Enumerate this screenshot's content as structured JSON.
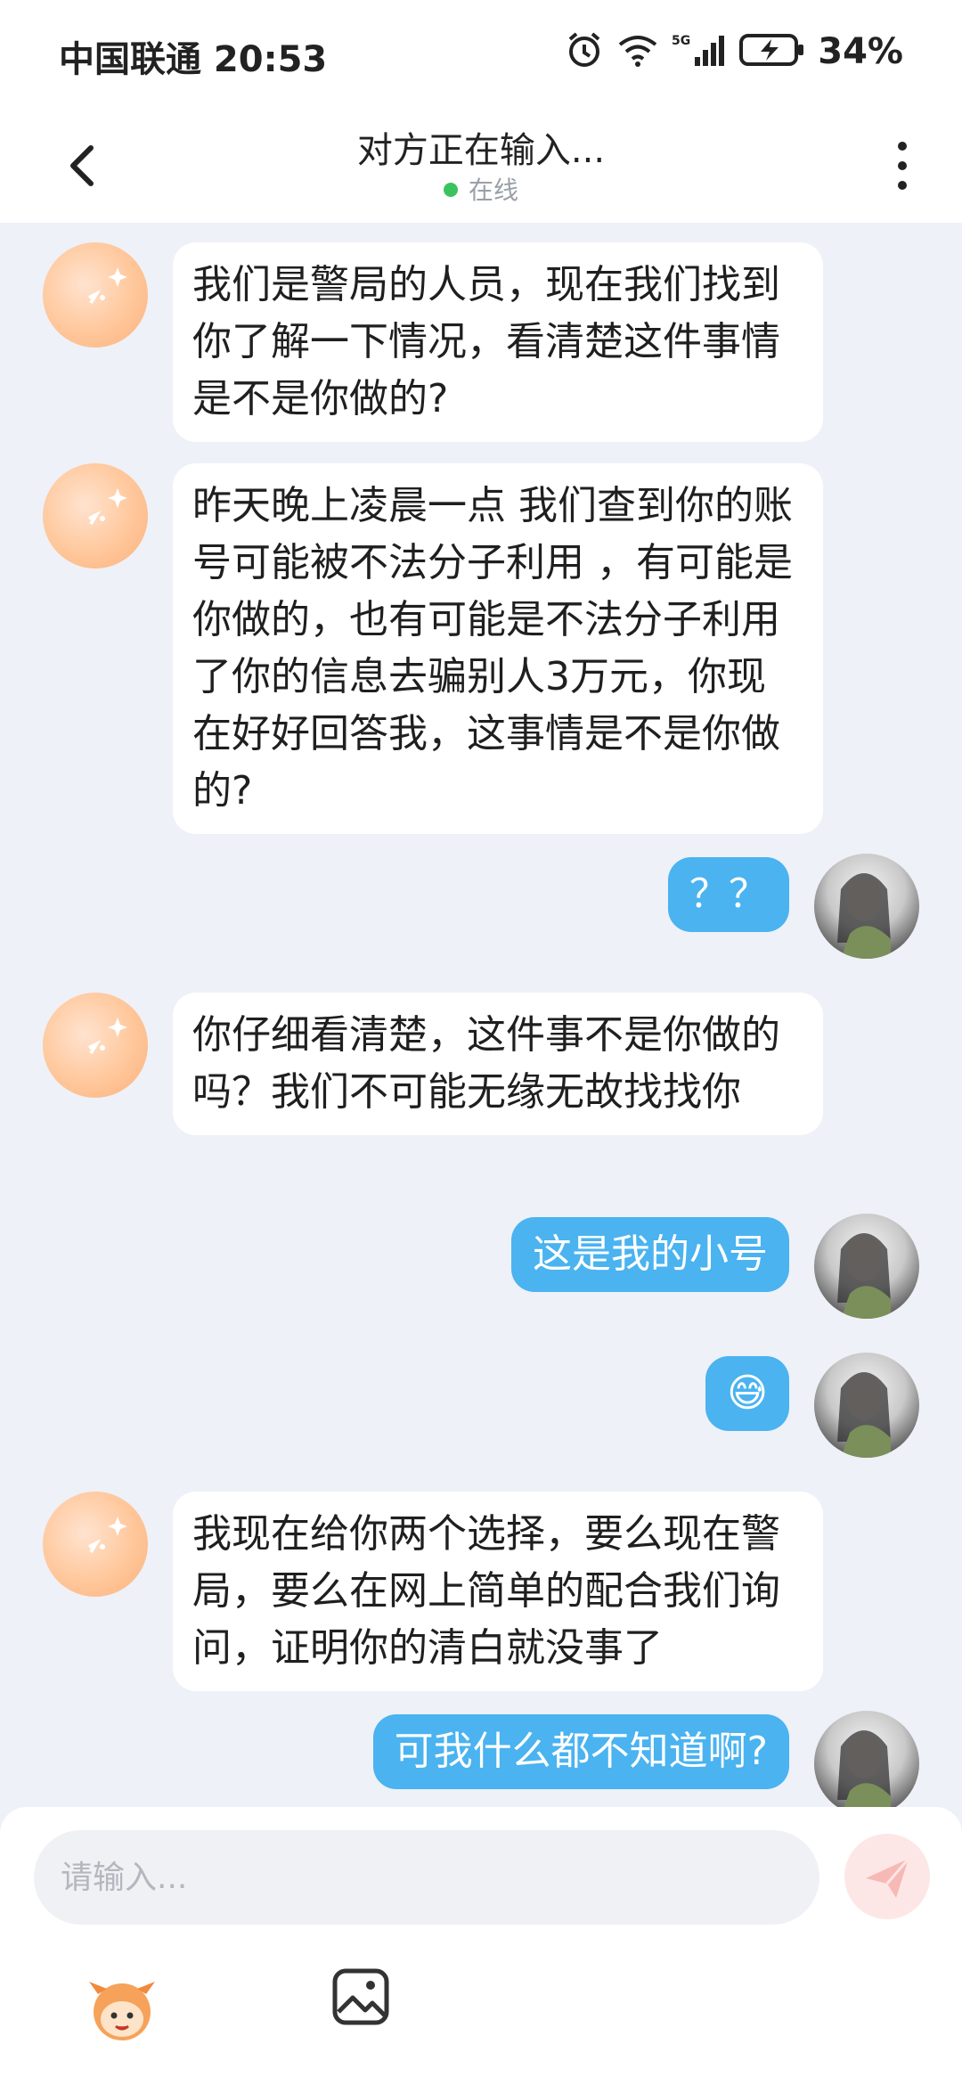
{
  "status_bar": {
    "carrier_time": "中国联通 20:53",
    "battery": "34%",
    "signal_label": "5G"
  },
  "header": {
    "title": "对方正在输入...",
    "status": "在线"
  },
  "messages": [
    {
      "side": "in",
      "text": "我们是警局的人员，现在我们找到你了解一下情况，看清楚这件事情是不是你做的?"
    },
    {
      "side": "in",
      "text": "昨天晚上凌晨一点 我们查到你的账号可能被不法分子利用 ，有可能是你做的，也有可能是不法分子利用了你的信息去骗别人3万元，你现在好好回答我，这事情是不是你做的?"
    },
    {
      "side": "out",
      "text": "？？"
    },
    {
      "side": "in",
      "text": "你仔细看清楚，这件事不是你做的吗？我们不可能无缘无故找找你"
    },
    {
      "side": "out",
      "text": "这是我的小号"
    },
    {
      "side": "out",
      "text": "😅"
    },
    {
      "side": "in",
      "text": "我现在给你两个选择，要么现在警局，要么在网上简单的配合我们询问，证明你的清白就没事了"
    },
    {
      "side": "out",
      "text": "可我什么都不知道啊?"
    }
  ],
  "input": {
    "placeholder": "请输入..."
  },
  "colors": {
    "outgoing_bubble": "#4ab3f0",
    "incoming_bubble": "#ffffff",
    "background": "#eef1f7",
    "online": "#3cc35f"
  },
  "icons": [
    "back-arrow-icon",
    "more-vert-icon",
    "send-icon",
    "mascot-icon",
    "image-icon"
  ]
}
